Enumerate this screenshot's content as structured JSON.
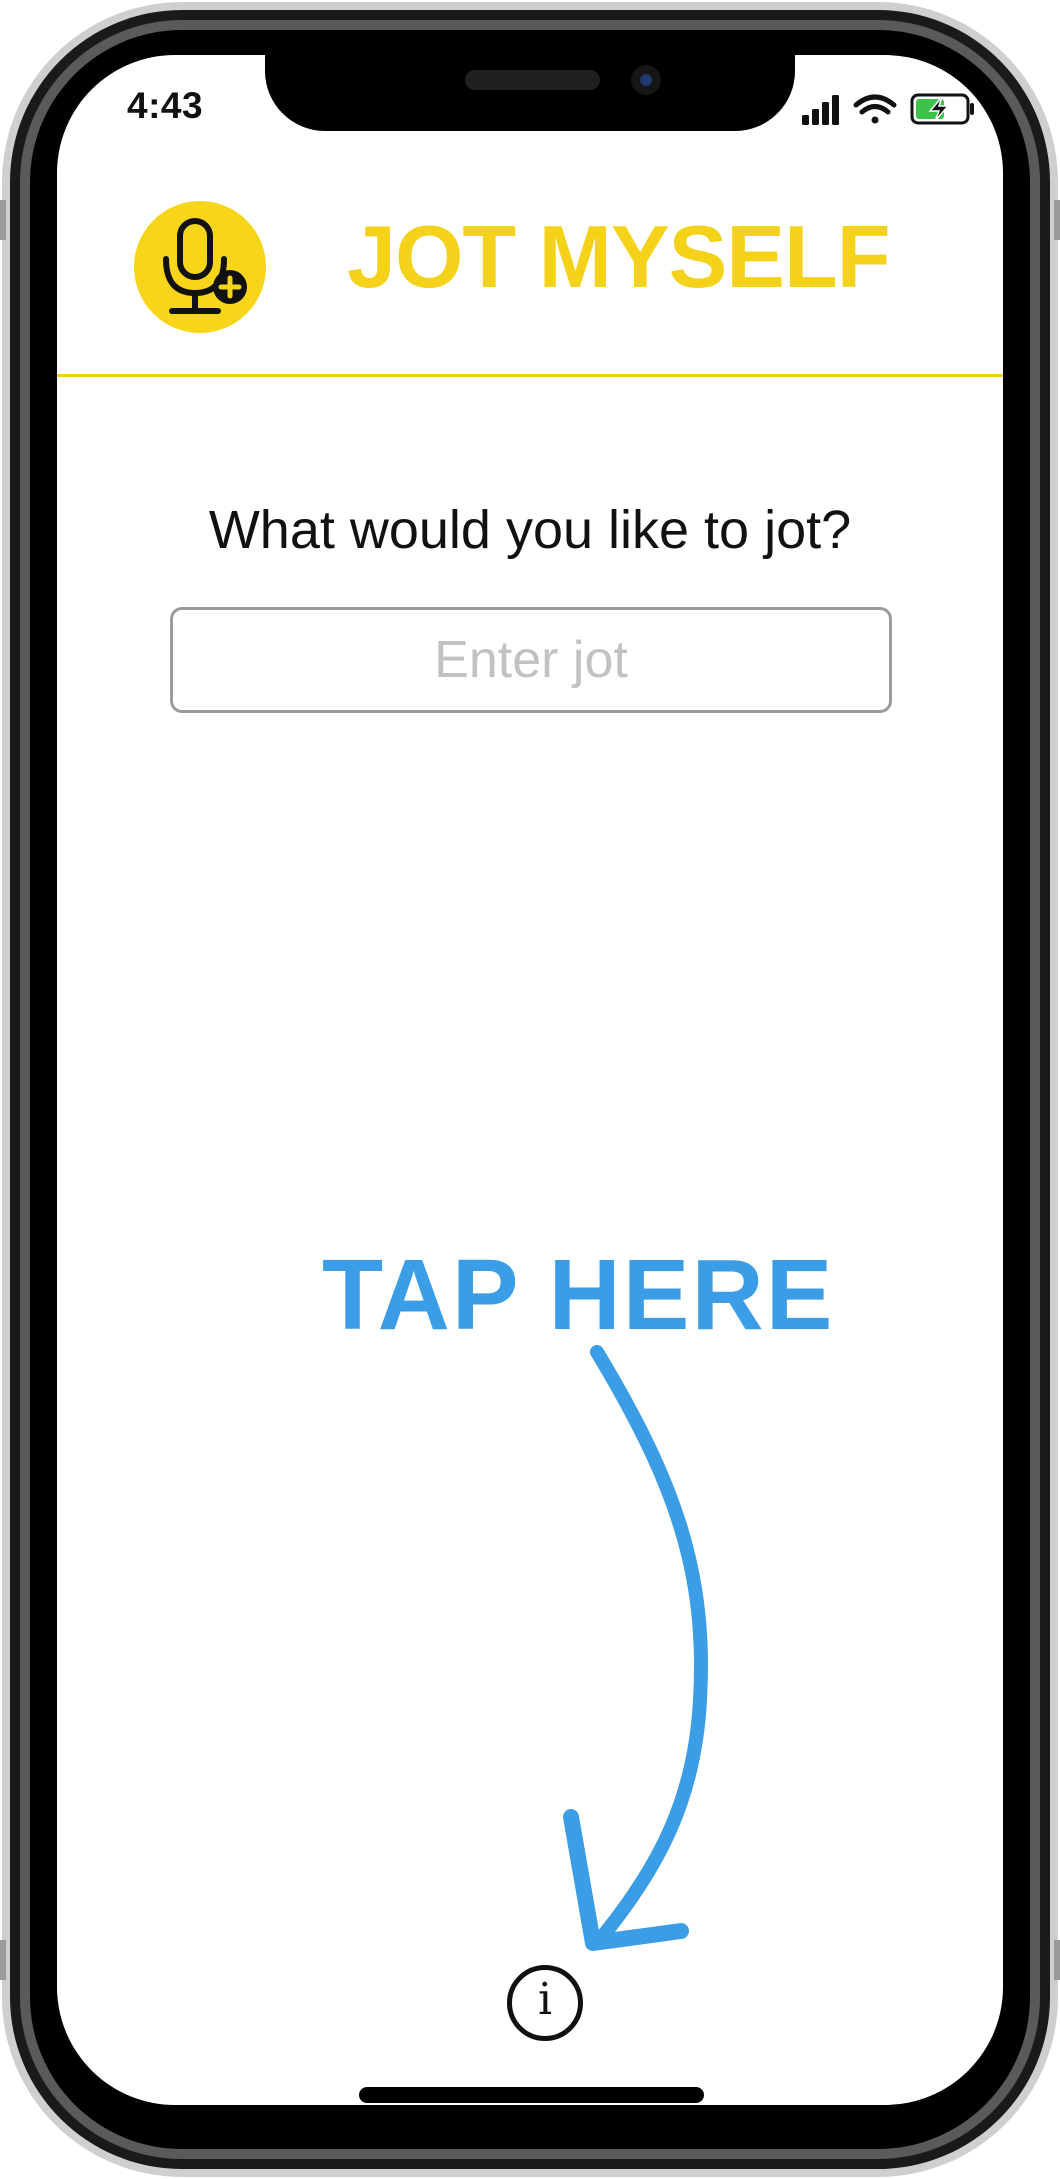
{
  "status_bar": {
    "time": "4:43",
    "battery_icon_color": "#3dc24a"
  },
  "header": {
    "title": "JOT MYSELF",
    "logo_icon": "microphone-plus-icon",
    "accent_color": "#f5d21a"
  },
  "main": {
    "prompt": "What would you like to jot?",
    "input_placeholder": "Enter jot",
    "input_value": ""
  },
  "hint": {
    "text": "TAP HERE",
    "color": "#3b9de6",
    "arrow_icon": "curved-arrow-icon"
  },
  "footer": {
    "info_icon": "info-icon",
    "info_glyph": "i"
  }
}
